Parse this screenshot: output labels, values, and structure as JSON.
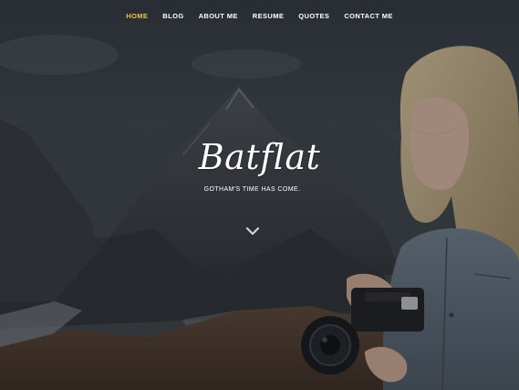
{
  "nav": {
    "items": [
      {
        "label": "HOME",
        "active": true
      },
      {
        "label": "BLOG",
        "active": false
      },
      {
        "label": "ABOUT ME",
        "active": false
      },
      {
        "label": "RESUME",
        "active": false
      },
      {
        "label": "QUOTES",
        "active": false
      },
      {
        "label": "CONTACT ME",
        "active": false
      }
    ]
  },
  "hero": {
    "title": "Batflat",
    "tagline": "GOTHAM'S TIME HAS COME."
  },
  "icons": {
    "scroll": "chevron-down-icon"
  },
  "colors": {
    "accent": "#f2c14e",
    "text": "#ffffff"
  }
}
